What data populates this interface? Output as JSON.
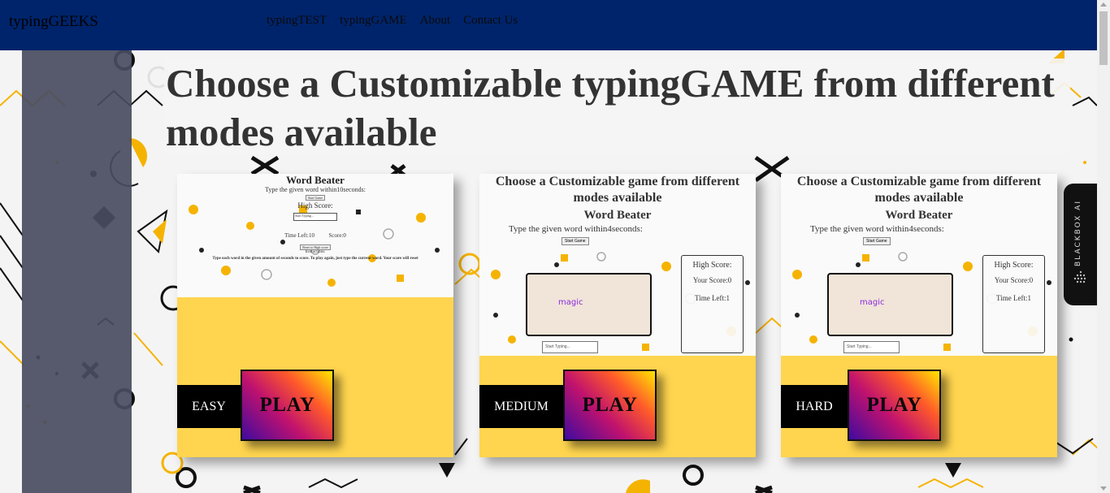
{
  "nav": {
    "brand": "typingGEEKS",
    "links": [
      "typingTEST",
      "typingGAME",
      "About",
      "Contact Us"
    ]
  },
  "heading": "Choose a Customizable typingGAME from different modes available",
  "cards": [
    {
      "level": "EASY",
      "play": "PLAY",
      "preview": {
        "title": "Word Beater",
        "subtitle": "Type the given word within10seconds:",
        "start": "Start Game",
        "high_score": "High Score:",
        "input_placeholder": "Start Typing...",
        "time_left": "Time Left:10",
        "score": "Score:0",
        "reset_button": "Reset to High score",
        "instructions_label": "Instructions:",
        "instructions": "Type each word in the given amount of seconds to score. To play again, just type the current word. Your score will reset"
      }
    },
    {
      "level": "MEDIUM",
      "play": "PLAY",
      "preview": {
        "heading": "Choose a Customizable game from different modes available",
        "title": "Word Beater",
        "subtitle": "Type the given word within4seconds:",
        "start": "Start Game",
        "word": "magic",
        "high_score": "High Score:",
        "your_score": "Your Score:0",
        "time_left": "Time Left:1",
        "input_placeholder": "Start Typing..."
      }
    },
    {
      "level": "HARD",
      "play": "PLAY",
      "preview": {
        "heading": "Choose a Customizable game from different modes available",
        "title": "Word Beater",
        "subtitle": "Type the given word within4seconds:",
        "start": "Start Game",
        "word": "magic",
        "high_score": "High Score:",
        "your_score": "Your Score:0",
        "time_left": "Time Left:1",
        "input_placeholder": "Start Typing..."
      }
    }
  ],
  "sidebar_tab": {
    "label": "BLACKBOX AI",
    "icon": "blackbox-logo-icon"
  },
  "colors": {
    "navbar": "#00246b",
    "card": "#ffd54f",
    "sidebar": "#484c60",
    "accent_yellow": "#f5b301"
  }
}
